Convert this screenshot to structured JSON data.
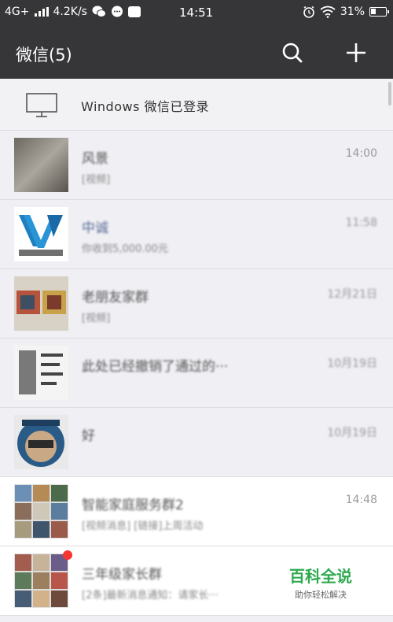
{
  "statusbar": {
    "network": "4G+",
    "speed": "4.2K/s",
    "time": "14:51",
    "battery": "31%"
  },
  "header": {
    "title": "微信(5)",
    "search_icon": "search-icon",
    "add_icon": "plus-icon"
  },
  "login_banner": {
    "text": "Windows 微信已登录",
    "icon": "monitor-icon"
  },
  "chats": [
    {
      "name": "风景",
      "preview": "[视频]",
      "time": "14:00"
    },
    {
      "name": "中诚",
      "preview": "你收到5,000.00元",
      "time": "11:58"
    },
    {
      "name": "老朋友家群",
      "preview": "[视频]",
      "time": "12月21日"
    },
    {
      "name": "此处已经撤销了通过的···",
      "preview": "",
      "time": "10月19日"
    },
    {
      "name": "好",
      "preview": "",
      "time": "10月19日"
    },
    {
      "name": "智能家庭服务群2",
      "preview": "[视频消息] [链接]上周活动",
      "time": "14:48"
    },
    {
      "name": "三年级家长群",
      "preview": "[2条]最新消息通知：请家长···",
      "time": ""
    }
  ],
  "watermark": {
    "title": "百科全说",
    "subtitle": "助你轻松解决"
  },
  "colors": {
    "bar": "#363639",
    "list_bg": "#efeff4",
    "unread": "#f43530",
    "watermark_green": "#2daa4f"
  }
}
